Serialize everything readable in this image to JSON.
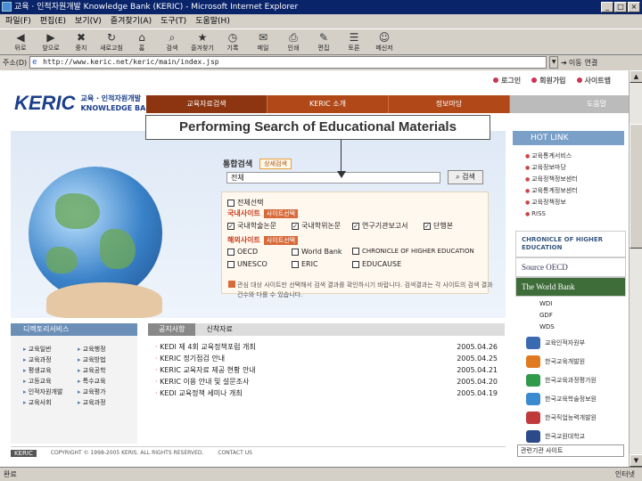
{
  "window": {
    "title": "교육 · 인적자원개발 Knowledge Bank (KERIC) - Microsoft Internet Explorer"
  },
  "menu": [
    "파일(F)",
    "편집(E)",
    "보기(V)",
    "즐겨찾기(A)",
    "도구(T)",
    "도움말(H)"
  ],
  "toolbar": [
    "뒤로",
    "앞으로",
    "중지",
    "새로고침",
    "홈",
    "검색",
    "즐겨찾기",
    "기록",
    "메일",
    "인쇄",
    "편집",
    "토론",
    "메신저"
  ],
  "address": {
    "label": "주소(D)",
    "url": "http://www.keric.net/keric/main/index.jsp",
    "go_label": "이동",
    "links_label": "연결"
  },
  "topnav": [
    "로그인",
    "회원가입",
    "사이트맵"
  ],
  "logo": {
    "name": "KERIC",
    "sub1": "교육 · 인적자원개발",
    "sub2": "KNOWLEDGE BANK"
  },
  "mainnav": [
    "교육자료검색",
    "KERIC 소개",
    "정보마당",
    "도움말"
  ],
  "overlay_title": "Performing Search of Educational Materials",
  "search": {
    "title": "통합검색",
    "chip": "상세검색",
    "scope": "전체",
    "button": "검색",
    "all_label": "전체선택",
    "domestic_label": "국내사이트",
    "domestic_tag": "사이트선택",
    "domestic": [
      "국내학술논문",
      "국내학위논문",
      "연구기관보고서",
      "단행본"
    ],
    "overseas_label": "해외사이트",
    "overseas_tag": "사이트선택",
    "overseas_row1": [
      "OECD",
      "World Bank",
      "CHRONICLE OF HIGHER EDUCATION"
    ],
    "overseas_row2": [
      "UNESCO",
      "ERIC",
      "EDUCAUSE"
    ]
  },
  "notice": "관심 대상 사이트만 선택해서 검색 결과를 확인하시기 바랍니다. 검색결과는 각 사이트의 검색 결과 건수와 다를 수 있습니다.",
  "hotlink": {
    "title": "HOT LINK",
    "items": [
      "교육통계서비스",
      "교육정보마당",
      "교육정책정보센터",
      "교육통계정보센터",
      "교육정책정보",
      "RISS"
    ]
  },
  "promos": {
    "chronicle": "CHRONICLE OF HIGHER EDUCATION",
    "oecd": "Source OECD",
    "worldbank": "The World Bank",
    "wb_items": [
      "WDI",
      "GDF",
      "WDS"
    ]
  },
  "orgs": [
    "교육인적자원부",
    "한국교육개발원",
    "한국교육과정평가원",
    "한국교육학술정보원",
    "한국직업능력개발원",
    "한국교원대학교"
  ],
  "org_select": "관련기관 사이트",
  "left_service": {
    "title": "디렉토리서비스",
    "items": [
      "교육일반",
      "교육행정",
      "교육과정",
      "교육방법",
      "평생교육",
      "교육공학",
      "고등교육",
      "특수교육",
      "인적자원개발",
      "교육평가",
      "교육사회",
      "교육과정"
    ]
  },
  "news": {
    "tabs": [
      "공지사항",
      "신착자료"
    ],
    "items": [
      {
        "title": "KEDI 제 4회 교육정책포럼 개최",
        "date": "2005.04.26"
      },
      {
        "title": "KERIC 정기점검 안내",
        "date": "2005.04.25"
      },
      {
        "title": "KERIC 교육자료 제공 현황 안내",
        "date": "2005.04.21"
      },
      {
        "title": "KERIC 이용 안내 및 설문조사",
        "date": "2005.04.20"
      },
      {
        "title": "KEDI 교육정책 세미나 개최",
        "date": "2005.04.19"
      }
    ]
  },
  "footer": {
    "logo": "KERIC",
    "copyright": "COPYRIGHT © 1998-2005 KERIS. ALL RIGHTS RESERVED.",
    "contact": "CONTACT US"
  },
  "status": {
    "left": "완료",
    "right": "인터넷"
  }
}
